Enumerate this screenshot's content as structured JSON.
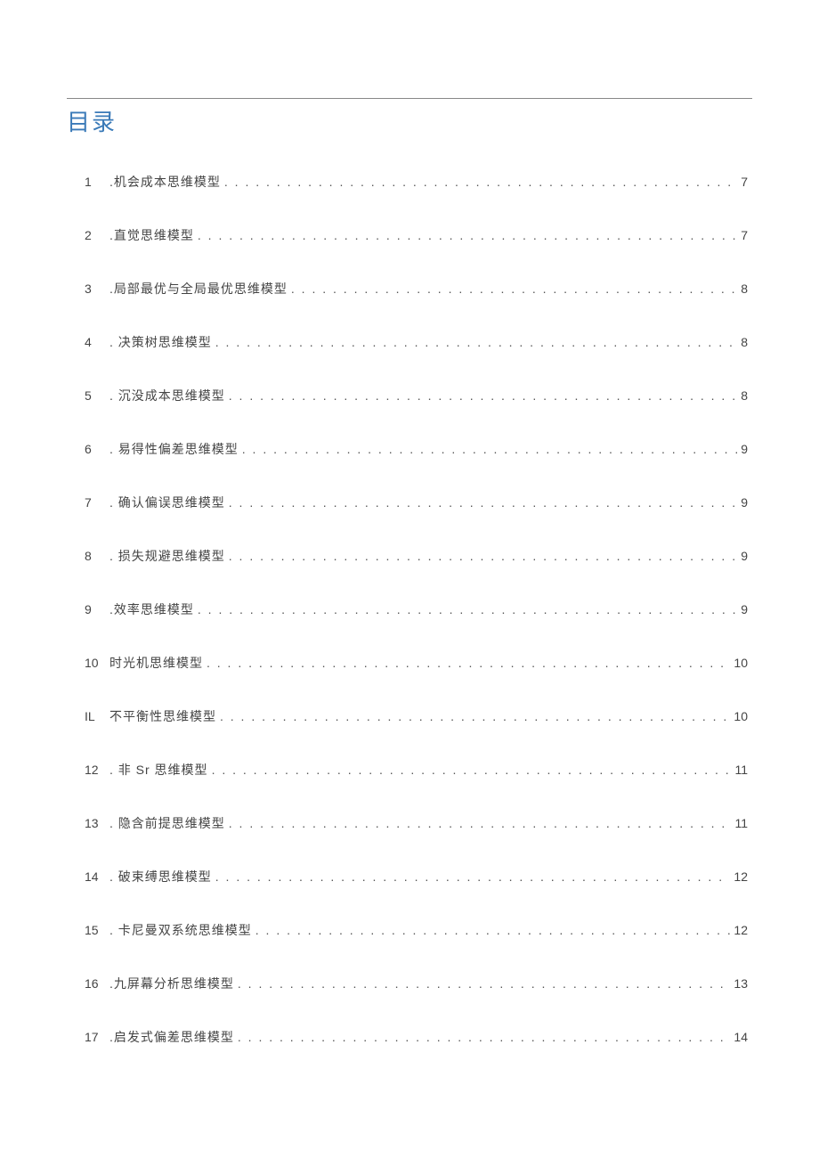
{
  "title": "目录",
  "entries": [
    {
      "num": "1",
      "label": ".机会成本思维模型",
      "page": "7"
    },
    {
      "num": "2",
      "label": ".直觉思维模型",
      "page": "7"
    },
    {
      "num": "3",
      "label": ".局部最优与全局最优思维模型",
      "page": "8"
    },
    {
      "num": "4",
      "label": ". 决策树思维模型",
      "page": "8"
    },
    {
      "num": "5",
      "label": ". 沉没成本思维模型",
      "page": "8"
    },
    {
      "num": "6",
      "label": ". 易得性偏差思维模型",
      "page": "9"
    },
    {
      "num": "7",
      "label": ". 确认偏误思维模型",
      "page": "9"
    },
    {
      "num": "8",
      "label": ". 损失规避思维模型",
      "page": "9"
    },
    {
      "num": "9",
      "label": ".效率思维模型",
      "page": "9"
    },
    {
      "num": "10",
      "label": "时光机思维模型",
      "page": "10"
    },
    {
      "num": "IL",
      "label": "不平衡性思维模型",
      "page": "10"
    },
    {
      "num": "12",
      "label": " . 非 Sr 思维模型",
      "page": "11"
    },
    {
      "num": "13",
      "label": " . 隐含前提思维模型",
      "page": "11"
    },
    {
      "num": "14",
      "label": " . 破束缚思维模型",
      "page": "12"
    },
    {
      "num": "15",
      "label": " . 卡尼曼双系统思维模型",
      "page": "12"
    },
    {
      "num": "16",
      "label": " .九屏幕分析思维模型",
      "page": "13"
    },
    {
      "num": "17",
      "label": " .启发式偏差思维模型",
      "page": "14"
    }
  ]
}
